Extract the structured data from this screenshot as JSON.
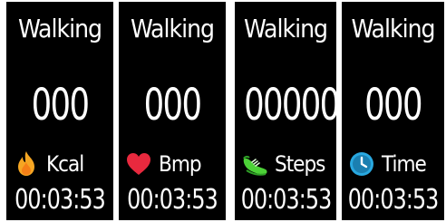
{
  "screens": [
    {
      "title": "Walking",
      "value": "000",
      "metric_label": "Kcal",
      "icon": "flame-icon",
      "time": "00:03:53"
    },
    {
      "title": "Walking",
      "value": "000",
      "metric_label": "Bmp",
      "icon": "heart-icon",
      "time": "00:03:53"
    },
    {
      "title": "Walking",
      "value": "00000",
      "metric_label": "Steps",
      "icon": "shoe-icon",
      "time": "00:03:53"
    },
    {
      "title": "Walking",
      "value": "000",
      "metric_label": "Time",
      "icon": "clock-icon",
      "time": "00:03:53"
    }
  ],
  "colors": {
    "background": "#000000",
    "text": "#ffffff",
    "flame": "#f5a623",
    "heart": "#e8293e",
    "shoe": "#4cd137",
    "clock": "#29a8e0"
  }
}
